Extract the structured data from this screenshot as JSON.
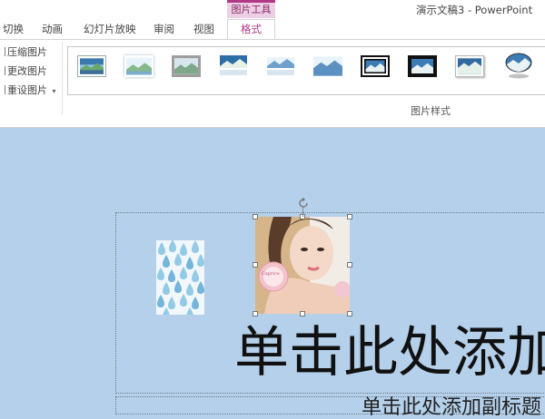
{
  "window": {
    "title": "演示文稿3 - PowerPoint"
  },
  "ribbon": {
    "context_group": "图片工具",
    "tabs": [
      "切换",
      "动画",
      "幻灯片放映",
      "审阅",
      "视图"
    ],
    "active_tab": "格式",
    "adjust_group": {
      "compress": "压缩图片",
      "change": "更改图片",
      "reset": "重设图片"
    },
    "styles_group": {
      "label": "图片样式",
      "style_icons": [
        "simple-frame-icon",
        "soft-edge-icon",
        "thick-matte-icon",
        "reflected-icon",
        "soft-reflected-icon",
        "bevel-rect-icon",
        "double-frame-icon",
        "black-frame-icon",
        "beveled-matte-icon",
        "oval-reflected-icon"
      ]
    }
  },
  "slide": {
    "title_placeholder": "单击此处添加",
    "subtitle_placeholder": "单击此处添加副标题",
    "images": [
      {
        "name": "droplet-pattern-image",
        "desc_colors": [
          "#9fd1ea",
          "#6fb3dc"
        ]
      },
      {
        "name": "woman-cosmetics-photo",
        "badge_text": "Caprice"
      }
    ]
  },
  "colors": {
    "accent": "#b03a88",
    "canvas_bg": "#b4d0ea",
    "ribbon_bg": "#ffffff"
  }
}
